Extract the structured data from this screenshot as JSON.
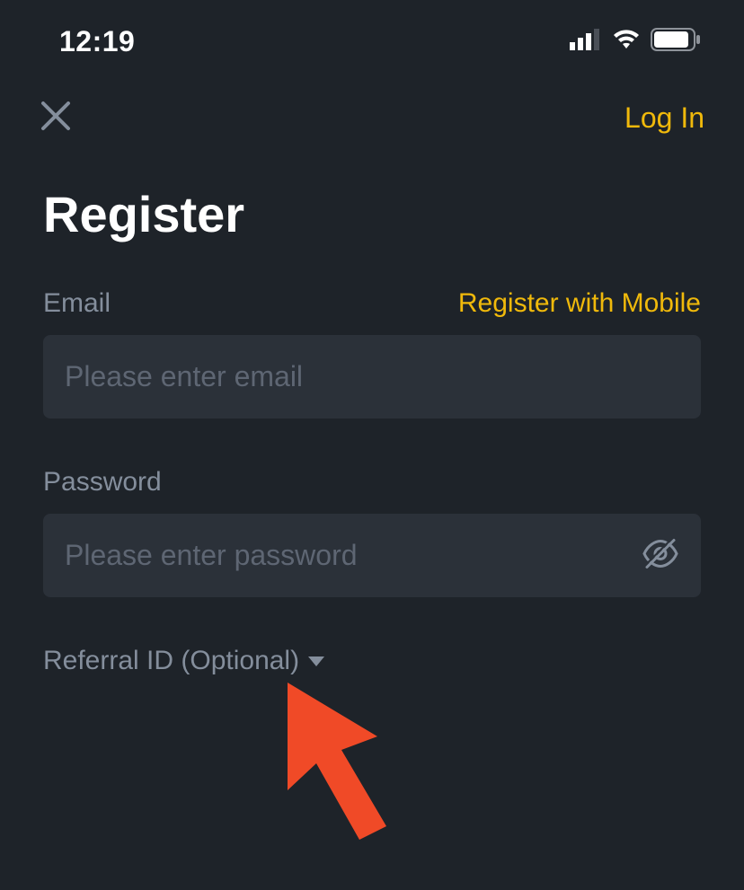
{
  "status": {
    "time": "12:19"
  },
  "nav": {
    "login_label": "Log In"
  },
  "page": {
    "title": "Register"
  },
  "form": {
    "email_label": "Email",
    "register_mobile_label": "Register with Mobile",
    "email_placeholder": "Please enter email",
    "password_label": "Password",
    "password_placeholder": "Please enter password",
    "referral_label": "Referral ID (Optional)"
  }
}
